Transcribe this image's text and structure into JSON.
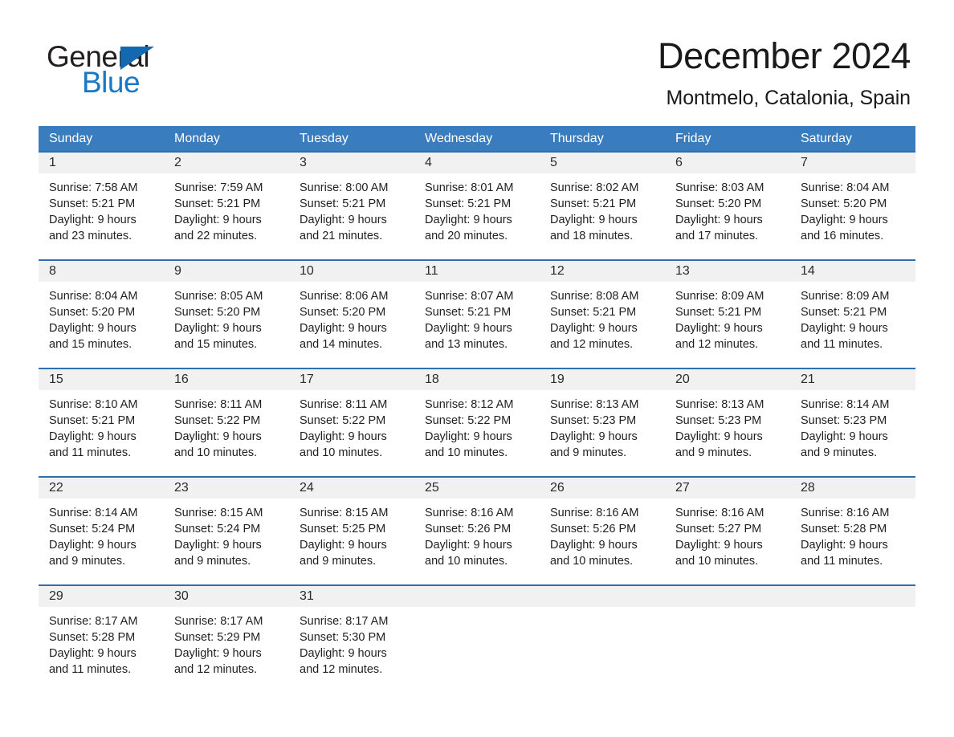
{
  "brand": {
    "name_part1": "General",
    "name_part2": "Blue",
    "accent_color": "#1578c8",
    "triangle_color": "#1468b0"
  },
  "header": {
    "title": "December 2024",
    "location": "Montmelo, Catalonia, Spain"
  },
  "calendar": {
    "header_bg": "#3a7dbe",
    "header_text_color": "#ffffff",
    "row_separator_color": "#2f6fb0",
    "daynum_band_bg": "#f1f1f1",
    "weekdays": [
      "Sunday",
      "Monday",
      "Tuesday",
      "Wednesday",
      "Thursday",
      "Friday",
      "Saturday"
    ],
    "weeks": [
      [
        {
          "day": "1",
          "l1": "Sunrise: 7:58 AM",
          "l2": "Sunset: 5:21 PM",
          "l3": "Daylight: 9 hours",
          "l4": "and 23 minutes."
        },
        {
          "day": "2",
          "l1": "Sunrise: 7:59 AM",
          "l2": "Sunset: 5:21 PM",
          "l3": "Daylight: 9 hours",
          "l4": "and 22 minutes."
        },
        {
          "day": "3",
          "l1": "Sunrise: 8:00 AM",
          "l2": "Sunset: 5:21 PM",
          "l3": "Daylight: 9 hours",
          "l4": "and 21 minutes."
        },
        {
          "day": "4",
          "l1": "Sunrise: 8:01 AM",
          "l2": "Sunset: 5:21 PM",
          "l3": "Daylight: 9 hours",
          "l4": "and 20 minutes."
        },
        {
          "day": "5",
          "l1": "Sunrise: 8:02 AM",
          "l2": "Sunset: 5:21 PM",
          "l3": "Daylight: 9 hours",
          "l4": "and 18 minutes."
        },
        {
          "day": "6",
          "l1": "Sunrise: 8:03 AM",
          "l2": "Sunset: 5:20 PM",
          "l3": "Daylight: 9 hours",
          "l4": "and 17 minutes."
        },
        {
          "day": "7",
          "l1": "Sunrise: 8:04 AM",
          "l2": "Sunset: 5:20 PM",
          "l3": "Daylight: 9 hours",
          "l4": "and 16 minutes."
        }
      ],
      [
        {
          "day": "8",
          "l1": "Sunrise: 8:04 AM",
          "l2": "Sunset: 5:20 PM",
          "l3": "Daylight: 9 hours",
          "l4": "and 15 minutes."
        },
        {
          "day": "9",
          "l1": "Sunrise: 8:05 AM",
          "l2": "Sunset: 5:20 PM",
          "l3": "Daylight: 9 hours",
          "l4": "and 15 minutes."
        },
        {
          "day": "10",
          "l1": "Sunrise: 8:06 AM",
          "l2": "Sunset: 5:20 PM",
          "l3": "Daylight: 9 hours",
          "l4": "and 14 minutes."
        },
        {
          "day": "11",
          "l1": "Sunrise: 8:07 AM",
          "l2": "Sunset: 5:21 PM",
          "l3": "Daylight: 9 hours",
          "l4": "and 13 minutes."
        },
        {
          "day": "12",
          "l1": "Sunrise: 8:08 AM",
          "l2": "Sunset: 5:21 PM",
          "l3": "Daylight: 9 hours",
          "l4": "and 12 minutes."
        },
        {
          "day": "13",
          "l1": "Sunrise: 8:09 AM",
          "l2": "Sunset: 5:21 PM",
          "l3": "Daylight: 9 hours",
          "l4": "and 12 minutes."
        },
        {
          "day": "14",
          "l1": "Sunrise: 8:09 AM",
          "l2": "Sunset: 5:21 PM",
          "l3": "Daylight: 9 hours",
          "l4": "and 11 minutes."
        }
      ],
      [
        {
          "day": "15",
          "l1": "Sunrise: 8:10 AM",
          "l2": "Sunset: 5:21 PM",
          "l3": "Daylight: 9 hours",
          "l4": "and 11 minutes."
        },
        {
          "day": "16",
          "l1": "Sunrise: 8:11 AM",
          "l2": "Sunset: 5:22 PM",
          "l3": "Daylight: 9 hours",
          "l4": "and 10 minutes."
        },
        {
          "day": "17",
          "l1": "Sunrise: 8:11 AM",
          "l2": "Sunset: 5:22 PM",
          "l3": "Daylight: 9 hours",
          "l4": "and 10 minutes."
        },
        {
          "day": "18",
          "l1": "Sunrise: 8:12 AM",
          "l2": "Sunset: 5:22 PM",
          "l3": "Daylight: 9 hours",
          "l4": "and 10 minutes."
        },
        {
          "day": "19",
          "l1": "Sunrise: 8:13 AM",
          "l2": "Sunset: 5:23 PM",
          "l3": "Daylight: 9 hours",
          "l4": "and 9 minutes."
        },
        {
          "day": "20",
          "l1": "Sunrise: 8:13 AM",
          "l2": "Sunset: 5:23 PM",
          "l3": "Daylight: 9 hours",
          "l4": "and 9 minutes."
        },
        {
          "day": "21",
          "l1": "Sunrise: 8:14 AM",
          "l2": "Sunset: 5:23 PM",
          "l3": "Daylight: 9 hours",
          "l4": "and 9 minutes."
        }
      ],
      [
        {
          "day": "22",
          "l1": "Sunrise: 8:14 AM",
          "l2": "Sunset: 5:24 PM",
          "l3": "Daylight: 9 hours",
          "l4": "and 9 minutes."
        },
        {
          "day": "23",
          "l1": "Sunrise: 8:15 AM",
          "l2": "Sunset: 5:24 PM",
          "l3": "Daylight: 9 hours",
          "l4": "and 9 minutes."
        },
        {
          "day": "24",
          "l1": "Sunrise: 8:15 AM",
          "l2": "Sunset: 5:25 PM",
          "l3": "Daylight: 9 hours",
          "l4": "and 9 minutes."
        },
        {
          "day": "25",
          "l1": "Sunrise: 8:16 AM",
          "l2": "Sunset: 5:26 PM",
          "l3": "Daylight: 9 hours",
          "l4": "and 10 minutes."
        },
        {
          "day": "26",
          "l1": "Sunrise: 8:16 AM",
          "l2": "Sunset: 5:26 PM",
          "l3": "Daylight: 9 hours",
          "l4": "and 10 minutes."
        },
        {
          "day": "27",
          "l1": "Sunrise: 8:16 AM",
          "l2": "Sunset: 5:27 PM",
          "l3": "Daylight: 9 hours",
          "l4": "and 10 minutes."
        },
        {
          "day": "28",
          "l1": "Sunrise: 8:16 AM",
          "l2": "Sunset: 5:28 PM",
          "l3": "Daylight: 9 hours",
          "l4": "and 11 minutes."
        }
      ],
      [
        {
          "day": "29",
          "l1": "Sunrise: 8:17 AM",
          "l2": "Sunset: 5:28 PM",
          "l3": "Daylight: 9 hours",
          "l4": "and 11 minutes."
        },
        {
          "day": "30",
          "l1": "Sunrise: 8:17 AM",
          "l2": "Sunset: 5:29 PM",
          "l3": "Daylight: 9 hours",
          "l4": "and 12 minutes."
        },
        {
          "day": "31",
          "l1": "Sunrise: 8:17 AM",
          "l2": "Sunset: 5:30 PM",
          "l3": "Daylight: 9 hours",
          "l4": "and 12 minutes."
        },
        {
          "day": "",
          "l1": "",
          "l2": "",
          "l3": "",
          "l4": ""
        },
        {
          "day": "",
          "l1": "",
          "l2": "",
          "l3": "",
          "l4": ""
        },
        {
          "day": "",
          "l1": "",
          "l2": "",
          "l3": "",
          "l4": ""
        },
        {
          "day": "",
          "l1": "",
          "l2": "",
          "l3": "",
          "l4": ""
        }
      ]
    ]
  }
}
